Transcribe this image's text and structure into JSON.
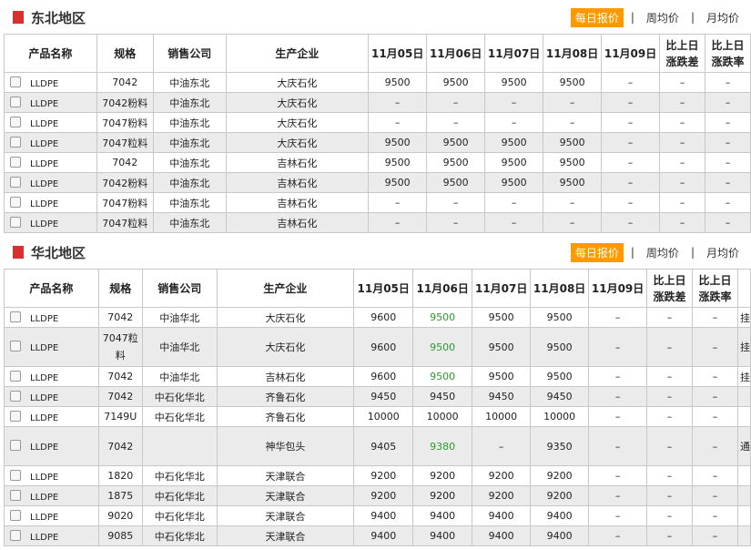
{
  "tabs": {
    "daily": "每日报价",
    "separator": "|",
    "weekly": "周均价",
    "monthly": "月均价"
  },
  "columns": {
    "product": "产品名称",
    "spec": "规格",
    "seller": "销售公司",
    "producer": "生产企业",
    "d1": "11月05日",
    "d2": "11月06日",
    "d3": "11月07日",
    "d4": "11月08日",
    "d5": "11月09日",
    "diff_l1": "比上日",
    "diff_l2": "涨跌差",
    "rate_l1": "比上日",
    "rate_l2": "涨跌率"
  },
  "northeast": {
    "title": "东北地区",
    "rows": [
      {
        "product": "LLDPE",
        "spec": "7042",
        "seller": "中油东北",
        "producer": "大庆石化",
        "d1": "9500",
        "d2": "9500",
        "d3": "9500",
        "d4": "9500",
        "d5": "–",
        "diff": "–",
        "rate": "–"
      },
      {
        "product": "LLDPE",
        "spec": "7042粉料",
        "seller": "中油东北",
        "producer": "大庆石化",
        "d1": "–",
        "d2": "–",
        "d3": "–",
        "d4": "–",
        "d5": "–",
        "diff": "–",
        "rate": "–"
      },
      {
        "product": "LLDPE",
        "spec": "7047粉料",
        "seller": "中油东北",
        "producer": "大庆石化",
        "d1": "–",
        "d2": "–",
        "d3": "–",
        "d4": "–",
        "d5": "–",
        "diff": "–",
        "rate": "–"
      },
      {
        "product": "LLDPE",
        "spec": "7047粒料",
        "seller": "中油东北",
        "producer": "大庆石化",
        "d1": "9500",
        "d2": "9500",
        "d3": "9500",
        "d4": "9500",
        "d5": "–",
        "diff": "–",
        "rate": "–"
      },
      {
        "product": "LLDPE",
        "spec": "7042",
        "seller": "中油东北",
        "producer": "吉林石化",
        "d1": "9500",
        "d2": "9500",
        "d3": "9500",
        "d4": "9500",
        "d5": "–",
        "diff": "–",
        "rate": "–"
      },
      {
        "product": "LLDPE",
        "spec": "7042粉料",
        "seller": "中油东北",
        "producer": "吉林石化",
        "d1": "9500",
        "d2": "9500",
        "d3": "9500",
        "d4": "9500",
        "d5": "–",
        "diff": "–",
        "rate": "–"
      },
      {
        "product": "LLDPE",
        "spec": "7047粉料",
        "seller": "中油东北",
        "producer": "吉林石化",
        "d1": "–",
        "d2": "–",
        "d3": "–",
        "d4": "–",
        "d5": "–",
        "diff": "–",
        "rate": "–"
      },
      {
        "product": "LLDPE",
        "spec": "7047粒料",
        "seller": "中油东北",
        "producer": "吉林石化",
        "d1": "–",
        "d2": "–",
        "d3": "–",
        "d4": "–",
        "d5": "–",
        "diff": "–",
        "rate": "–"
      }
    ]
  },
  "north": {
    "title": "华北地区",
    "rows": [
      {
        "product": "LLDPE",
        "spec": "7042",
        "seller": "中油华北",
        "producer": "大庆石化",
        "d1": "9600",
        "d2": "9500",
        "d3": "9500",
        "d4": "9500",
        "d5": "–",
        "diff": "–",
        "rate": "–",
        "extra": "挂"
      },
      {
        "product": "LLDPE",
        "spec": "7047粒料",
        "seller": "中油华北",
        "producer": "大庆石化",
        "d1": "9600",
        "d2": "9500",
        "d3": "9500",
        "d4": "9500",
        "d5": "–",
        "diff": "–",
        "rate": "–",
        "extra": "挂"
      },
      {
        "product": "LLDPE",
        "spec": "7042",
        "seller": "中油华北",
        "producer": "吉林石化",
        "d1": "9600",
        "d2": "9500",
        "d3": "9500",
        "d4": "9500",
        "d5": "–",
        "diff": "–",
        "rate": "–",
        "extra": "挂"
      },
      {
        "product": "LLDPE",
        "spec": "7042",
        "seller": "中石化华北",
        "producer": "齐鲁石化",
        "d1": "9450",
        "d2": "9450",
        "d3": "9450",
        "d4": "9450",
        "d5": "–",
        "diff": "–",
        "rate": "–",
        "extra": ""
      },
      {
        "product": "LLDPE",
        "spec": "7149U",
        "seller": "中石化华北",
        "producer": "齐鲁石化",
        "d1": "10000",
        "d2": "10000",
        "d3": "10000",
        "d4": "10000",
        "d5": "–",
        "diff": "–",
        "rate": "–",
        "extra": ""
      },
      {
        "product": "LLDPE",
        "spec": "7042",
        "seller": "",
        "producer": "神华包头",
        "d1": "9405",
        "d2": "9380",
        "d3": "–",
        "d4": "9350",
        "d5": "–",
        "diff": "–",
        "rate": "–",
        "extra": "通"
      },
      {
        "product": "LLDPE",
        "spec": "1820",
        "seller": "中石化华北",
        "producer": "天津联合",
        "d1": "9200",
        "d2": "9200",
        "d3": "9200",
        "d4": "9200",
        "d5": "–",
        "diff": "–",
        "rate": "–",
        "extra": ""
      },
      {
        "product": "LLDPE",
        "spec": "1875",
        "seller": "中石化华北",
        "producer": "天津联合",
        "d1": "9200",
        "d2": "9200",
        "d3": "9200",
        "d4": "9200",
        "d5": "–",
        "diff": "–",
        "rate": "–",
        "extra": ""
      },
      {
        "product": "LLDPE",
        "spec": "9020",
        "seller": "中石化华北",
        "producer": "天津联合",
        "d1": "9400",
        "d2": "9400",
        "d3": "9400",
        "d4": "9400",
        "d5": "–",
        "diff": "–",
        "rate": "–",
        "extra": ""
      },
      {
        "product": "LLDPE",
        "spec": "9085",
        "seller": "中石化华北",
        "producer": "天津联合",
        "d1": "9400",
        "d2": "9400",
        "d3": "9400",
        "d4": "9400",
        "d5": "–",
        "diff": "–",
        "rate": "–",
        "extra": ""
      }
    ]
  },
  "colors": {
    "accent": "#ff9900",
    "marker": "#d8302f",
    "green": "#2a9a2a",
    "row_alt": "#ebebeb"
  }
}
